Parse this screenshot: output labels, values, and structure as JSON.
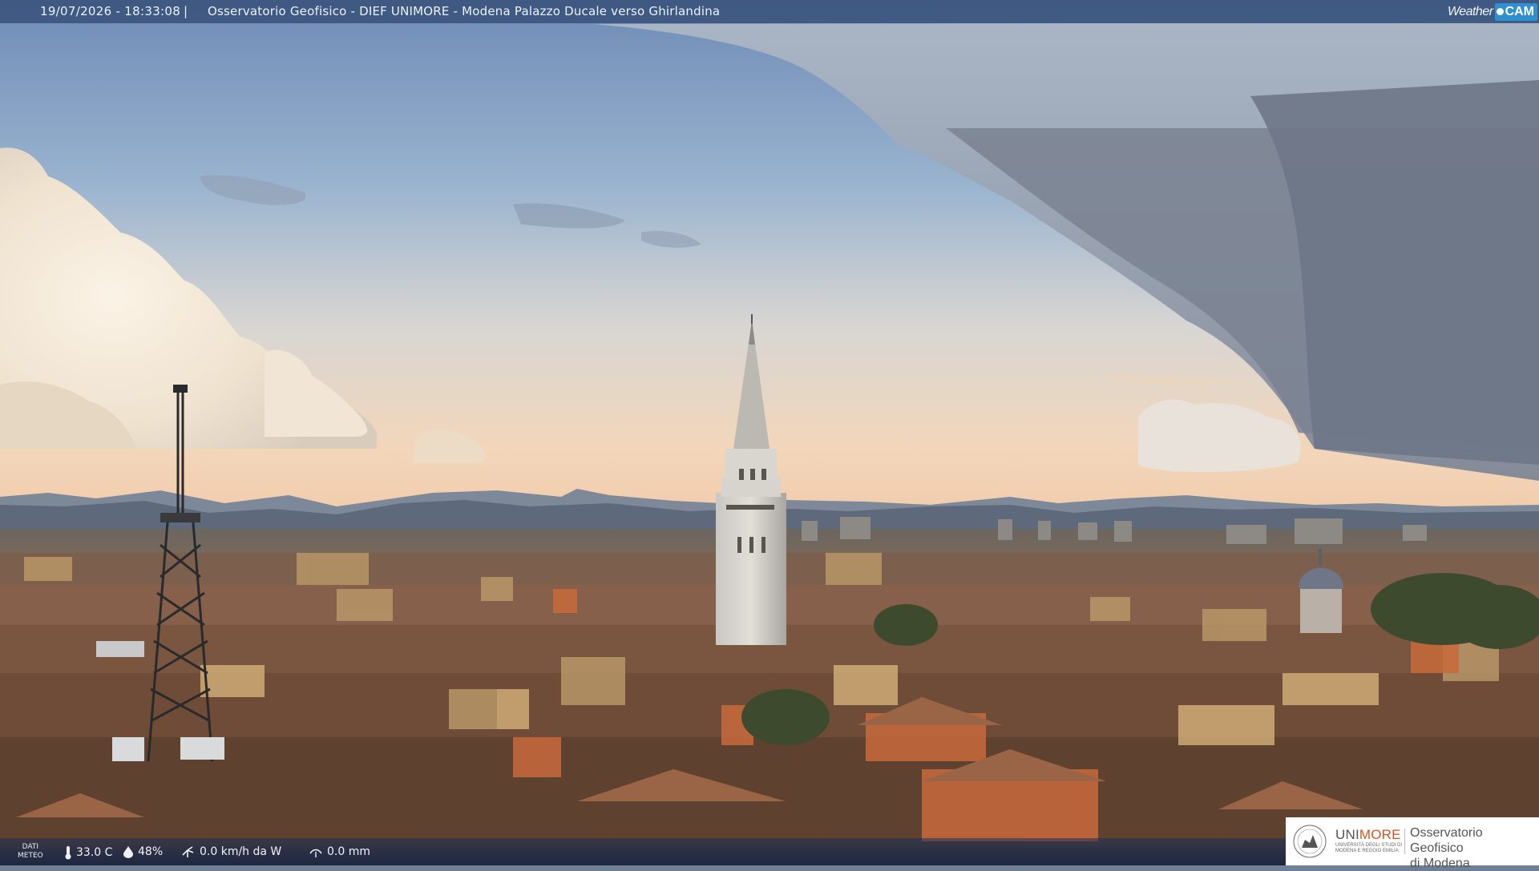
{
  "header": {
    "timestamp": "19/07/2026 - 18:33:08",
    "separator": "|",
    "caption": "Osservatorio Geofisico - DIEF UNIMORE - Modena Palazzo Ducale verso Ghirlandina",
    "brand_weather": "Weather",
    "brand_cam": "CAM"
  },
  "weather_strip": {
    "dati_label_1": "DATI",
    "dati_label_2": "METEO",
    "temperature": "33.0 C",
    "temperature_icon": "thermometer-icon",
    "humidity": "48%",
    "humidity_icon": "droplet-icon",
    "wind": "0.0 km/h da W",
    "wind_icon": "wind-icon",
    "rain": "0.0 mm",
    "rain_icon": "rain-gauge-icon"
  },
  "logo": {
    "uni_prefix": "UNI",
    "uni_suffix": "MORE",
    "uni_sub_1": "UNIVERSITÀ DEGLI STUDI DI",
    "uni_sub_2": "MODENA E REGGIO EMILIA",
    "observatory_line_1": "Osservatorio Geofisico",
    "observatory_line_2": "di Modena",
    "accent_color": "#d9531e"
  },
  "colors": {
    "sky_top": "#6e8db8",
    "sky_horizon": "#f2d3b6",
    "storm_cloud": "#7e8896",
    "header_bar": "#344e78",
    "rooftops": "#8a5a3e"
  }
}
